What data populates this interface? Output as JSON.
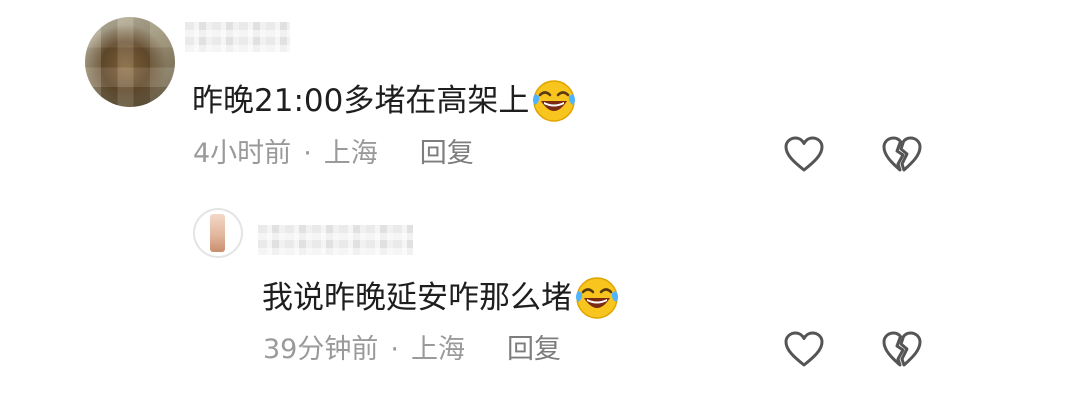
{
  "comment": {
    "text": "昨晚21:00多堵在高架上",
    "emoji_icon": "laughing-crying-face-icon",
    "time": "4小时前",
    "separator": "·",
    "location": "上海",
    "reply_label": "回复"
  },
  "reply": {
    "text": "我说昨晚延安咋那么堵",
    "emoji_icon": "laughing-crying-face-icon",
    "time": "39分钟前",
    "separator": "·",
    "location": "上海",
    "reply_label": "回复"
  },
  "icons": {
    "like": "heart-outline-icon",
    "dislike": "broken-heart-icon"
  },
  "colors": {
    "text": "#1e1e1e",
    "meta": "#9a9a9a",
    "icon_stroke": "#555555",
    "emoji_face": "#f7c51e"
  }
}
